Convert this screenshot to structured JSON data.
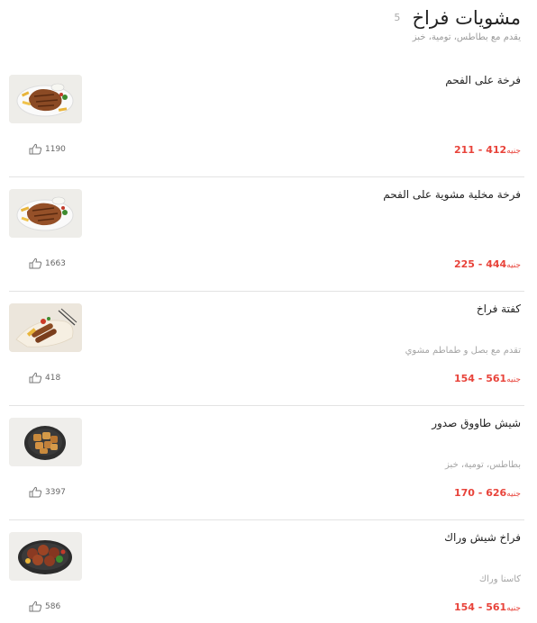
{
  "category": {
    "title": "مشويات فراخ",
    "count": "5",
    "description": "يقدم مع بطاطس، تومية، خبز"
  },
  "currency": "جنيه",
  "items": [
    {
      "name": "فرخة على الفحم",
      "description": "",
      "price_from": "211",
      "price_to": "412",
      "likes": "1190",
      "image_icon": "grilled-chicken-plate"
    },
    {
      "name": "فرخة مخلية مشوية على الفحم",
      "description": "",
      "price_from": "225",
      "price_to": "444",
      "likes": "1663",
      "image_icon": "grilled-chicken-plate"
    },
    {
      "name": "كفتة فراخ",
      "description": "تقدم مع بصل و طماطم مشوي",
      "price_from": "154",
      "price_to": "561",
      "likes": "418",
      "image_icon": "kofta-plate"
    },
    {
      "name": "شيش طاووق صدور",
      "description": "بطاطس، تومية، خبز",
      "price_from": "170",
      "price_to": "626",
      "likes": "3397",
      "image_icon": "shish-tawook-plate"
    },
    {
      "name": "فراخ شيش وراك",
      "description": "كاسنا وراك",
      "price_from": "154",
      "price_to": "561",
      "likes": "586",
      "image_icon": "shish-thigh-plate"
    }
  ]
}
